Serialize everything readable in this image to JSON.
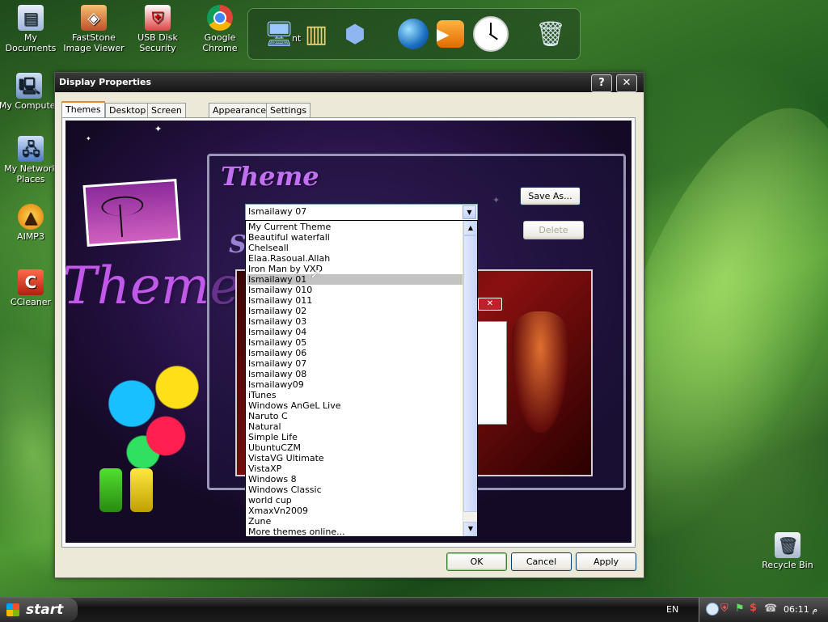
{
  "desktop": {
    "icons": [
      {
        "label": "My Documents",
        "icon": "folder-documents-icon"
      },
      {
        "label": "FastStone Image Viewer",
        "icon": "faststone-icon"
      },
      {
        "label": "USB Disk Security",
        "icon": "usb-shield-icon"
      },
      {
        "label": "Google Chrome",
        "icon": "chrome-icon"
      },
      {
        "label": "My Computer",
        "icon": "computer-icon"
      },
      {
        "label": "My Network Places",
        "icon": "network-icon"
      },
      {
        "label": "AIMP3",
        "icon": "aimp-icon"
      },
      {
        "label": "CCleaner",
        "icon": "ccleaner-icon"
      },
      {
        "label": "Recycle Bin",
        "icon": "recycle-bin-icon"
      }
    ],
    "dock_partial_label": "nt"
  },
  "dialog": {
    "title": "Display Properties",
    "help_glyph": "?",
    "close_glyph": "✕",
    "tabs": [
      "Themes",
      "Desktop",
      "Screen Saver",
      "Appearance",
      "Settings"
    ],
    "active_tab": "Themes",
    "art_text": {
      "themes": "Themes",
      "theme_heading": "Theme"
    },
    "theme_combo_value": "Ismailawy 07",
    "save_as_label": "Save As...",
    "delete_label": "Delete",
    "theme_options": [
      "My Current Theme",
      "Beautiful waterfall",
      "Chelseall",
      "Elaa.Rasoual.Allah",
      "Iron Man by VXD",
      "Ismailawy 01",
      "Ismailawy 010",
      "Ismailawy 011",
      "Ismailawy 02",
      "Ismailawy 03",
      "Ismailawy 04",
      "Ismailawy 05",
      "Ismailawy 06",
      "Ismailawy 07",
      "Ismailawy 08",
      "Ismailawy09",
      "iTunes",
      "Windows AnGeL Live",
      "Naruto C",
      "Natural",
      "Simple Life",
      "UbuntuCZM",
      "VistaVG Ultimate",
      "VistaXP",
      "Windows 8",
      "Windows Classic",
      "world cup",
      "XmaxVn2009",
      "Zune",
      "More themes online..."
    ],
    "highlighted_option": "Ismailawy 01",
    "ok_label": "OK",
    "cancel_label": "Cancel",
    "apply_label": "Apply"
  },
  "taskbar": {
    "start_label": "start",
    "language": "EN",
    "clock": "06:11 م"
  },
  "colors": {
    "title_bar": "#1c1c1c",
    "selection": "#c3c3c3",
    "art_purple": "#3b1e66"
  }
}
